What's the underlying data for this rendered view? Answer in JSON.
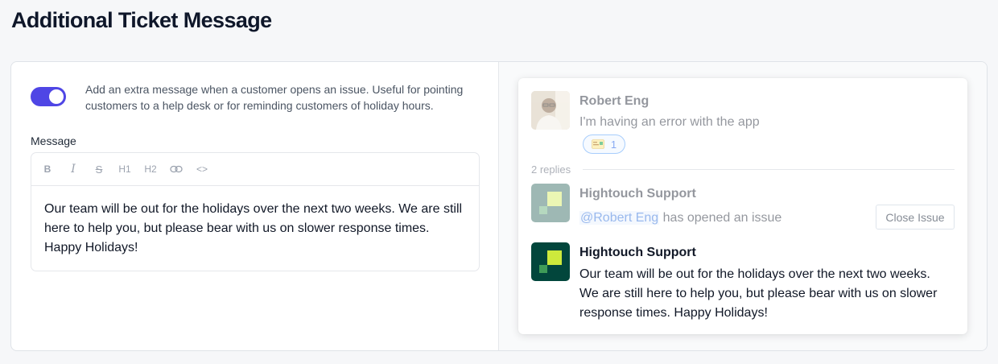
{
  "page": {
    "title": "Additional Ticket Message"
  },
  "settings": {
    "toggle_on": true,
    "toggle_description": "Add an extra message when a customer opens an issue. Useful for pointing customers to a help desk or for reminding customers of holiday hours.",
    "message_label": "Message",
    "toolbar": {
      "bold": "B",
      "italic": "I",
      "strike": "S",
      "h1": "H1",
      "h2": "H2",
      "link": "link-icon",
      "code": "<>"
    },
    "message_text": "Our team will be out for the holidays over the next two weeks. We are still here to help you, but please bear with us on slower response times. Happy Holidays!"
  },
  "preview": {
    "first_message": {
      "author": "Robert Eng",
      "text": "I'm having an error with the app",
      "reaction_count": "1"
    },
    "replies_label": "2 replies",
    "opened_message": {
      "author": "Hightouch Support",
      "mention": "@Robert Eng",
      "text": "has opened an issue",
      "button": "Close Issue"
    },
    "extra_message": {
      "author": "Hightouch Support",
      "text": "Our team will be out for the holidays over the next two weeks. We are still here to help you, but please bear with us on slower response times. Happy Holidays!"
    }
  },
  "colors": {
    "accent": "#4f46e5",
    "brand_dark": "#02463c",
    "brand_light": "#cde93c"
  }
}
